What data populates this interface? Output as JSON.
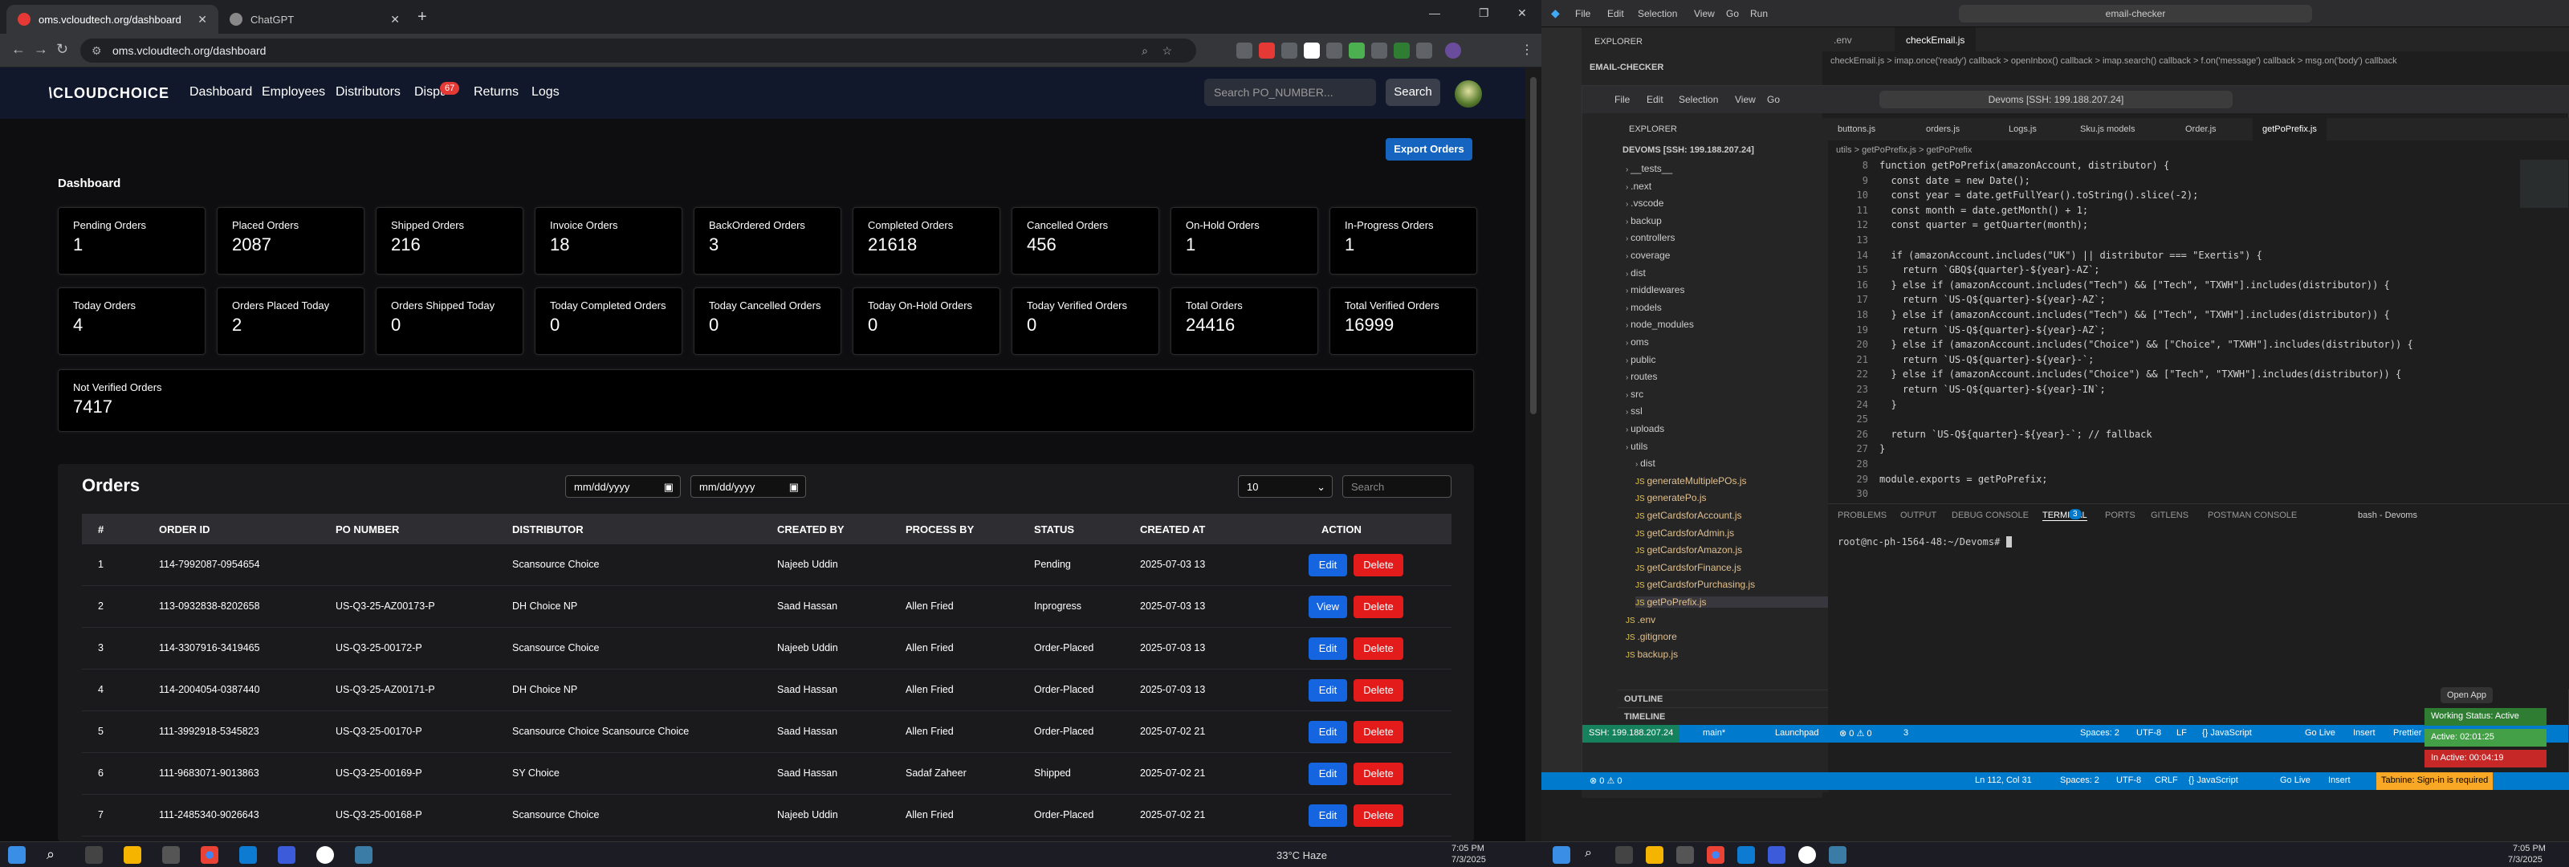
{
  "browser": {
    "tabs": [
      {
        "label": "oms.vcloudtech.org/dashboard"
      },
      {
        "label": "ChatGPT"
      }
    ],
    "url": "oms.vcloudtech.org/dashboard"
  },
  "app": {
    "logo": "CLOUDCHOICE",
    "nav": [
      "Dashboard",
      "Employees",
      "Distributors",
      "Disputes",
      "Returns",
      "Logs"
    ],
    "disputes_badge": "67",
    "search_placeholder": "Search PO_NUMBER...",
    "search_button": "Search",
    "export_button": "Export Orders",
    "dashboard_title": "Dashboard",
    "cards": [
      {
        "label": "Pending Orders",
        "value": "1"
      },
      {
        "label": "Placed Orders",
        "value": "2087"
      },
      {
        "label": "Shipped Orders",
        "value": "216"
      },
      {
        "label": "Invoice Orders",
        "value": "18"
      },
      {
        "label": "BackOrdered Orders",
        "value": "3"
      },
      {
        "label": "Completed Orders",
        "value": "21618"
      },
      {
        "label": "Cancelled Orders",
        "value": "456"
      },
      {
        "label": "On-Hold Orders",
        "value": "1"
      },
      {
        "label": "In-Progress Orders",
        "value": "1"
      },
      {
        "label": "Today Orders",
        "value": "4"
      },
      {
        "label": "Orders Placed Today",
        "value": "2"
      },
      {
        "label": "Orders Shipped Today",
        "value": "0"
      },
      {
        "label": "Today Completed Orders",
        "value": "0"
      },
      {
        "label": "Today Cancelled Orders",
        "value": "0"
      },
      {
        "label": "Today On-Hold Orders",
        "value": "0"
      },
      {
        "label": "Today Verified Orders",
        "value": "0"
      },
      {
        "label": "Total Orders",
        "value": "24416"
      },
      {
        "label": "Total Verified Orders",
        "value": "16999"
      }
    ],
    "not_verified": {
      "label": "Not Verified Orders",
      "value": "7417"
    },
    "orders": {
      "title": "Orders",
      "date_placeholder": "mm/dd/yyyy",
      "page_size": "10",
      "search_placeholder": "Search",
      "columns": [
        "#",
        "ORDER ID",
        "PO NUMBER",
        "DISTRIBUTOR",
        "CREATED BY",
        "PROCESS BY",
        "STATUS",
        "CREATED AT",
        "ACTION"
      ],
      "rows": [
        {
          "n": "1",
          "id": "114-7992087-0954654",
          "po": "",
          "dist": "Scansource Choice",
          "by": "Najeeb Uddin",
          "proc": "",
          "status": "Pending",
          "at": "2025-07-03 13",
          "action": "Edit"
        },
        {
          "n": "2",
          "id": "113-0932838-8202658",
          "po": "US-Q3-25-AZ00173-P",
          "dist": "DH Choice NP",
          "by": "Saad Hassan",
          "proc": "Allen Fried",
          "status": "Inprogress",
          "at": "2025-07-03 13",
          "action": "View"
        },
        {
          "n": "3",
          "id": "114-3307916-3419465",
          "po": "US-Q3-25-00172-P",
          "dist": "Scansource Choice",
          "by": "Najeeb Uddin",
          "proc": "Allen Fried",
          "status": "Order-Placed",
          "at": "2025-07-03 13",
          "action": "Edit"
        },
        {
          "n": "4",
          "id": "114-2004054-0387440",
          "po": "US-Q3-25-AZ00171-P",
          "dist": "DH Choice NP",
          "by": "Saad Hassan",
          "proc": "Allen Fried",
          "status": "Order-Placed",
          "at": "2025-07-03 13",
          "action": "Edit"
        },
        {
          "n": "5",
          "id": "111-3992918-5345823",
          "po": "US-Q3-25-00170-P",
          "dist": "Scansource Choice Scansource Choice",
          "by": "Saad Hassan",
          "proc": "Allen Fried",
          "status": "Order-Placed",
          "at": "2025-07-02 21",
          "action": "Edit"
        },
        {
          "n": "6",
          "id": "111-9683071-9013863",
          "po": "US-Q3-25-00169-P",
          "dist": "SY Choice",
          "by": "Saad Hassan",
          "proc": "Sadaf Zaheer",
          "status": "Shipped",
          "at": "2025-07-02 21",
          "action": "Edit"
        },
        {
          "n": "7",
          "id": "111-2485340-9026643",
          "po": "US-Q3-25-00168-P",
          "dist": "Scansource Choice",
          "by": "Najeeb Uddin",
          "proc": "Allen Fried",
          "status": "Order-Placed",
          "at": "2025-07-02 21",
          "action": "Edit"
        }
      ],
      "delete_label": "Delete"
    }
  },
  "taskbar_left": {
    "weather": "33°C  Haze",
    "time": "7:05 PM",
    "date": "7/3/2025"
  },
  "vscode": {
    "menu": [
      "File",
      "Edit",
      "Selection",
      "View",
      "Go",
      "Run"
    ],
    "search": "email-checker",
    "inner_search": "Devoms [SSH: 199.188.207.24]",
    "outer_explorer": "EXPLORER",
    "outer_folder": "EMAIL-CHECKER",
    "outer_tabs": [
      ".env",
      "checkEmail.js"
    ],
    "outer_breadcrumb": "checkEmail.js > imap.once('ready') callback > openInbox() callback > imap.search() callback > f.on('message') callback > msg.on('body') callback",
    "explorer_title": "EXPLORER",
    "root": "DEVOMS [SSH: 199.188.207.24]",
    "tree": [
      "__tests__",
      ".next",
      ".vscode",
      "backup",
      "controllers",
      "coverage",
      "dist",
      "middlewares",
      "models",
      "node_modules",
      "oms",
      "public",
      "routes",
      "src",
      "ssl",
      "uploads",
      "utils",
      "dist",
      "generateMultiplePOs.js",
      "generatePo.js",
      "getCardsforAccount.js",
      "getCardsforAdmin.js",
      "getCardsforAmazon.js",
      "getCardsforFinance.js",
      "getCardsforPurchasing.js",
      "getPoPrefix.js",
      ".env",
      ".gitignore",
      "backup.js"
    ],
    "tabs": [
      "buttons.js",
      "orders.js",
      "Logs.js",
      "Sku.js models",
      "Order.js",
      "getPoPrefix.js"
    ],
    "breadcrumb": "utils > getPoPrefix.js > getPoPrefix",
    "code": [
      {
        "n": "8",
        "t": "function getPoPrefix(amazonAccount, distributor) {"
      },
      {
        "n": "9",
        "t": "  const date = new Date();"
      },
      {
        "n": "10",
        "t": "  const year = date.getFullYear().toString().slice(-2);"
      },
      {
        "n": "11",
        "t": "  const month = date.getMonth() + 1;"
      },
      {
        "n": "12",
        "t": "  const quarter = getQuarter(month);"
      },
      {
        "n": "13",
        "t": ""
      },
      {
        "n": "14",
        "t": "  if (amazonAccount.includes(\"UK\") || distributor === \"Exertis\") {"
      },
      {
        "n": "15",
        "t": "    return `GBQ${quarter}-${year}-AZ`;"
      },
      {
        "n": "16",
        "t": "  } else if (amazonAccount.includes(\"Tech\") && [\"Tech\", \"TXWH\"].includes(distributor)) {"
      },
      {
        "n": "17",
        "t": "    return `US-Q${quarter}-${year}-AZ`;"
      },
      {
        "n": "18",
        "t": "  } else if (amazonAccount.includes(\"Tech\") && [\"Tech\", \"TXWH\"].includes(distributor)) {"
      },
      {
        "n": "19",
        "t": "    return `US-Q${quarter}-${year}-AZ`;"
      },
      {
        "n": "20",
        "t": "  } else if (amazonAccount.includes(\"Choice\") && [\"Choice\", \"TXWH\"].includes(distributor)) {"
      },
      {
        "n": "21",
        "t": "    return `US-Q${quarter}-${year}-`;"
      },
      {
        "n": "22",
        "t": "  } else if (amazonAccount.includes(\"Choice\") && [\"Tech\", \"TXWH\"].includes(distributor)) {"
      },
      {
        "n": "23",
        "t": "    return `US-Q${quarter}-${year}-IN`;"
      },
      {
        "n": "24",
        "t": "  }"
      },
      {
        "n": "25",
        "t": ""
      },
      {
        "n": "26",
        "t": "  return `US-Q${quarter}-${year}-`; // fallback"
      },
      {
        "n": "27",
        "t": "}"
      },
      {
        "n": "28",
        "t": ""
      },
      {
        "n": "29",
        "t": "module.exports = getPoPrefix;"
      },
      {
        "n": "30",
        "t": ""
      }
    ],
    "panel_tabs": [
      "PROBLEMS",
      "OUTPUT",
      "DEBUG CONSOLE",
      "TERMINAL",
      "PORTS",
      "GITLENS",
      "POSTMAN CONSOLE"
    ],
    "ports_badge": "3",
    "shell": "bash - Devoms",
    "terminal": "root@nc-ph-1564-48:~/Devoms# ",
    "outline": "OUTLINE",
    "timeline": "TIMELINE",
    "status_inner": [
      "SSH: 199.188.207.24",
      "main*",
      "Launchpad",
      "⊗ 0 ⚠ 0",
      "3",
      "Spaces: 2",
      "UTF-8",
      "LF",
      "{} JavaScript",
      "Go Live",
      "Insert",
      "Prettier"
    ],
    "status_outer": [
      "⊗ 0 ⚠ 0",
      "Ln 112, Col 31",
      "Spaces: 2",
      "UTF-8",
      "CRLF",
      "{} JavaScript",
      "Go Live",
      "Insert",
      "Tabnine: Sign-in is required"
    ],
    "open_app": "Open App",
    "working": {
      "status": "Working Status: Active",
      "active": "Active: 02:01:25",
      "inactive": "In Active: 00:04:19"
    },
    "time": "7:05 PM",
    "date": "7/3/2025"
  }
}
